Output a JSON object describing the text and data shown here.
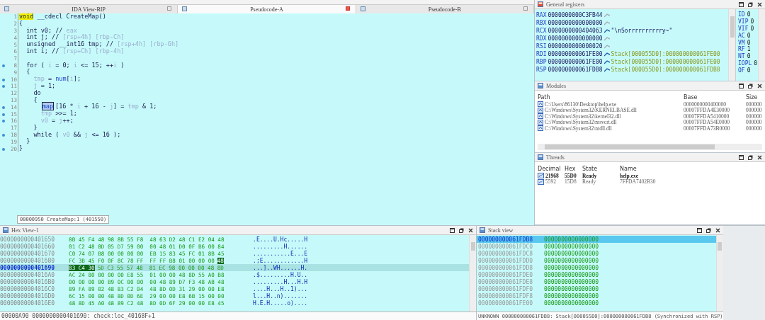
{
  "code_tabs": [
    {
      "label": "IDA View-RIP",
      "selected": false
    },
    {
      "label": "Pseudocode-A",
      "selected": true
    },
    {
      "label": "Pseudocode-B",
      "selected": false
    }
  ],
  "code": {
    "lines": [
      {
        "num": "1",
        "dot": false,
        "segs": [
          {
            "kind": "mark",
            "text": "void"
          },
          {
            "kind": "plain",
            "text": " __cdecl CreateMap()"
          }
        ]
      },
      {
        "num": "2",
        "dot": false,
        "segs": [
          {
            "kind": "plain",
            "text": "{"
          }
        ]
      },
      {
        "num": "3",
        "dot": false,
        "segs": [
          {
            "kind": "plain",
            "text": "int v0; //"
          },
          {
            "kind": "dim",
            "text": " eax"
          }
        ]
      },
      {
        "num": "4",
        "dot": false,
        "segs": [
          {
            "kind": "plain",
            "text": "int j; //"
          },
          {
            "kind": "dim",
            "text": " [rsp+4h] [rbp-Ch]"
          }
        ]
      },
      {
        "num": "5",
        "dot": false,
        "segs": [
          {
            "kind": "plain",
            "text": "unsigned __int16 tmp; //"
          },
          {
            "kind": "dim",
            "text": " [rsp+4h] [rbp-6h]"
          }
        ]
      },
      {
        "num": "6",
        "dot": false,
        "segs": [
          {
            "kind": "plain",
            "text": "int i; //"
          },
          {
            "kind": "dim",
            "text": " [rsp+Ch] [rbp-4h]"
          }
        ]
      },
      {
        "num": "7",
        "dot": false
      },
      {
        "num": "8",
        "dot": true,
        "segs": [
          {
            "kind": "plain",
            "text": "for ( "
          },
          {
            "kind": "dim",
            "text": "i"
          },
          {
            "kind": "plain",
            "text": " = 0; "
          },
          {
            "kind": "dim",
            "text": "i"
          },
          {
            "kind": "plain",
            "text": " <= 15; ++"
          },
          {
            "kind": "dim",
            "text": "i"
          },
          {
            "kind": "plain",
            "text": " )"
          }
        ]
      },
      {
        "num": "9",
        "dot": false,
        "segs": [
          {
            "kind": "plain",
            "text": "{"
          }
        ]
      },
      {
        "num": "10",
        "dot": true,
        "segs": [
          {
            "kind": "dim",
            "text": "tmp"
          },
          {
            "kind": "plain",
            "text": " = "
          },
          {
            "kind": "global",
            "text": "num"
          },
          {
            "kind": "plain",
            "text": "["
          },
          {
            "kind": "dim",
            "text": "i"
          },
          {
            "kind": "plain",
            "text": "];"
          }
        ]
      },
      {
        "num": "11",
        "dot": true,
        "segs": [
          {
            "kind": "dim",
            "text": "j"
          },
          {
            "kind": "plain",
            "text": " = 1;"
          }
        ]
      },
      {
        "num": "12",
        "dot": false,
        "segs": [
          {
            "kind": "plain",
            "text": "do"
          }
        ]
      },
      {
        "num": "13",
        "dot": false,
        "segs": [
          {
            "kind": "plain",
            "text": "{"
          }
        ]
      },
      {
        "num": "14",
        "dot": true,
        "segs": [
          {
            "kind": "boxed",
            "text": "map"
          },
          {
            "kind": "plain",
            "text": "[16 * "
          },
          {
            "kind": "dim",
            "text": "i"
          },
          {
            "kind": "plain",
            "text": " + 16 - "
          },
          {
            "kind": "dim",
            "text": "j"
          },
          {
            "kind": "plain",
            "text": "] = "
          },
          {
            "kind": "dim",
            "text": "tmp"
          },
          {
            "kind": "plain",
            "text": " & 1;"
          }
        ]
      },
      {
        "num": "15",
        "dot": true,
        "segs": [
          {
            "kind": "dim",
            "text": "tmp"
          },
          {
            "kind": "plain",
            "text": " >>= 1;"
          }
        ]
      },
      {
        "num": "16",
        "dot": true,
        "segs": [
          {
            "kind": "dim",
            "text": "v0"
          },
          {
            "kind": "plain",
            "text": " = "
          },
          {
            "kind": "dim",
            "text": "j"
          },
          {
            "kind": "plain",
            "text": "++;"
          }
        ]
      },
      {
        "num": "17",
        "dot": false,
        "segs": [
          {
            "kind": "plain",
            "text": "}"
          }
        ]
      },
      {
        "num": "18",
        "dot": true,
        "segs": [
          {
            "kind": "plain",
            "text": "while ( "
          },
          {
            "kind": "dim",
            "text": "v0"
          },
          {
            "kind": "plain",
            "text": " && "
          },
          {
            "kind": "dim",
            "text": "j"
          },
          {
            "kind": "plain",
            "text": " <= 16 );"
          }
        ]
      },
      {
        "num": "19",
        "dot": false,
        "segs": [
          {
            "kind": "plain",
            "text": "}"
          }
        ]
      },
      {
        "num": "20",
        "dot": true,
        "segs": [
          {
            "kind": "plain",
            "text": "}"
          }
        ]
      }
    ],
    "status": "00000950 CreateMap:1 (401550)"
  },
  "registers": {
    "title": "General registers",
    "rows": [
      {
        "name": "RAX",
        "value": "0000000000C3FB44",
        "linked": false
      },
      {
        "name": "RBX",
        "value": "0000000000000000",
        "linked": false
      },
      {
        "name": "RCX",
        "value": "0000000000404063",
        "linked": true,
        "detail": "\"\\nSorrrrrrrrrry~\"",
        "kind": "string"
      },
      {
        "name": "RDX",
        "value": "0000000000000000",
        "linked": false
      },
      {
        "name": "RSI",
        "value": "0000000000000020",
        "linked": false
      },
      {
        "name": "RDI",
        "value": "000000000061FE00",
        "linked": true,
        "detail": "Stack[000055D0]:000000000061FE00",
        "kind": "stack"
      },
      {
        "name": "RBP",
        "value": "000000000061FE00",
        "linked": true,
        "detail": "Stack[000055D0]:000000000061FE00",
        "kind": "stack"
      },
      {
        "name": "RSP",
        "value": "000000000061FDB8",
        "linked": true,
        "detail": "Stack[000055D0]:000000000061FDB8",
        "kind": "stack"
      }
    ],
    "flags": [
      {
        "name": "ID",
        "value": "0"
      },
      {
        "name": "VIP",
        "value": "0"
      },
      {
        "name": "VIF",
        "value": "0"
      },
      {
        "name": "AC",
        "value": "0"
      },
      {
        "name": "VM",
        "value": "0"
      },
      {
        "name": "RF",
        "value": "1"
      },
      {
        "name": "NT",
        "value": "0"
      },
      {
        "name": "IOPL",
        "value": "0"
      },
      {
        "name": "OF",
        "value": "0"
      }
    ]
  },
  "modules": {
    "title": "Modules",
    "columns": [
      "Path",
      "Base",
      "Size"
    ],
    "rows": [
      {
        "path": "C:\\Users\\86130\\Desktop\\help.exe",
        "base": "0000000000400000",
        "size": "000000"
      },
      {
        "path": "C:\\Windows\\System32\\KERNELBASE.dll",
        "base": "00007FFDA4E30000",
        "size": "000000"
      },
      {
        "path": "C:\\Windows\\System32\\kernel32.dll",
        "base": "00007FFDA5410000",
        "size": "000000"
      },
      {
        "path": "C:\\Windows\\System32\\msvcrt.dll",
        "base": "00007FFDA54E0000",
        "size": "000000"
      },
      {
        "path": "C:\\Windows\\System32\\ntdll.dll",
        "base": "00007FFDA73B0000",
        "size": "000000"
      }
    ]
  },
  "threads": {
    "title": "Threads",
    "columns": [
      "Decimal",
      "Hex",
      "State",
      "Name"
    ],
    "rows": [
      {
        "decimal": "21968",
        "hex": "55D0",
        "state": "Ready",
        "name": "help.exe",
        "selected": true
      },
      {
        "decimal": "5592",
        "hex": "15D8",
        "state": "Ready",
        "name": "7FFDA7402B30",
        "selected": false
      }
    ]
  },
  "hex_view": {
    "title": "Hex View-1",
    "rows": [
      {
        "address": "0000000000401650",
        "selected": false,
        "bytes": [
          {
            "text": "8B 45 F4 48 98 8B 55 F8  48 63 D2 48 C1 E2 04 48",
            "selected": false
          }
        ],
        "ascii": ".E....U.Hc.....H"
      },
      {
        "address": "0000000000401660",
        "selected": false,
        "bytes": [
          {
            "text": "01 C2 48 8D 05 D7 59 00  00 48 01 D0 0F B6 00 84",
            "selected": false
          }
        ],
        "ascii": ".........H......"
      },
      {
        "address": "0000000000401670",
        "selected": false,
        "bytes": [
          {
            "text": "C0 74 07 B8 00 00 00 00  EB 15 83 45 FC 01 8B 45",
            "selected": false
          }
        ],
        "ascii": "...........E...E"
      },
      {
        "address": "0000000000401680",
        "selected": false,
        "bytes": [
          {
            "text": "FC 3B 45 F0 0F 8C 78 FF  FF FF B8 01 00 00 00",
            "selected": false
          },
          {
            "text": "48",
            "selected": true
          }
        ],
        "ascii": ".;E............H"
      },
      {
        "address": "0000000000401690",
        "selected": true,
        "bytes": [
          {
            "text": "83 C4 30",
            "selected": true
          },
          {
            "text": "5D C3 55 57 48  81 EC 98 00 00 00 48 8D",
            "selected": false
          }
        ],
        "ascii": "...]..WH......H."
      },
      {
        "address": "00000000004016A0",
        "selected": false,
        "bytes": [
          {
            "text": "AC 24 80 00 00 00 E8 55  01 00 00 48 8D 55 A0 B8",
            "selected": false
          }
        ],
        "ascii": ".$.........H.U.."
      },
      {
        "address": "00000000004016B0",
        "selected": false,
        "bytes": [
          {
            "text": "00 00 00 00 B9 0C 00 00  00 48 89 D7 F3 48 AB 48",
            "selected": false
          }
        ],
        "ascii": ".........H...H.H"
      },
      {
        "address": "00000000004016C0",
        "selected": false,
        "bytes": [
          {
            "text": "89 FA 89 02 48 83 C2 04  48 8D 0D 31 29 00 00 E8",
            "selected": false
          }
        ],
        "ascii": "....H...H..1)..."
      },
      {
        "address": "00000000004016D0",
        "selected": false,
        "bytes": [
          {
            "text": "6C 15 00 00 48 8D 0D 6E  29 00 00 E8 6B 15 00 00",
            "selected": false
          }
        ],
        "ascii": "l...H..n)......."
      },
      {
        "address": "00000000004016E0",
        "selected": false,
        "bytes": [
          {
            "text": "48 8D 45 A0 48 89 C2 48  8D 0D 6F 29 00 00 E8 45",
            "selected": false
          }
        ],
        "ascii": "H.E.H.....o)...."
      }
    ],
    "status": "00000A90 0000000000401690: check:loc_40168F+1"
  },
  "stack_view": {
    "title": "Stack view",
    "rows": [
      {
        "address": "000000000061FDB8",
        "value": "0000000000000000",
        "selected": true
      },
      {
        "address": "000000000061FDC0",
        "value": "0000000000000000",
        "selected": false
      },
      {
        "address": "000000000061FDC8",
        "value": "0000000000000000",
        "selected": false
      },
      {
        "address": "000000000061FDD0",
        "value": "0000000000000000",
        "selected": false
      },
      {
        "address": "000000000061FDD8",
        "value": "0000000000000000",
        "selected": false
      },
      {
        "address": "000000000061FDE0",
        "value": "0000000000000000",
        "selected": false
      },
      {
        "address": "000000000061FDE8",
        "value": "0000000000000000",
        "selected": false
      },
      {
        "address": "000000000061FDF0",
        "value": "0000000000000000",
        "selected": false
      },
      {
        "address": "000000000061FDF8",
        "value": "0000000000000000",
        "selected": false
      },
      {
        "address": "000000000061FE00",
        "value": "0000000000000000",
        "selected": false
      }
    ],
    "status": "UNKNOWN 000000000061FDB8: Stack[000055D0]:000000000061FDB8 (Synchronized with RSP)"
  }
}
